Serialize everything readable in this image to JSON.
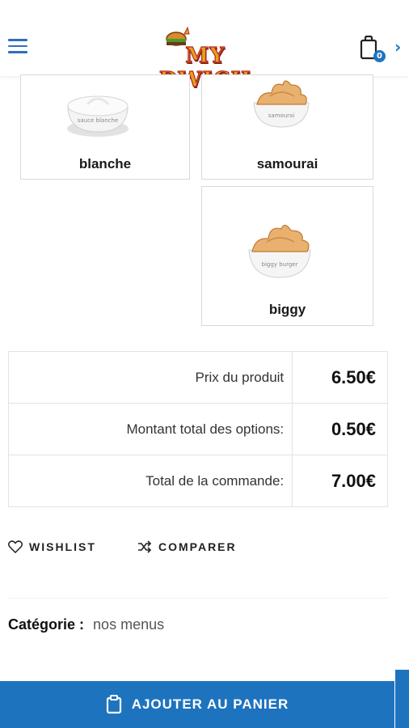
{
  "header": {
    "logo_text": "MY DWICH",
    "cart_count": "0"
  },
  "options": [
    {
      "label": "blanche",
      "jar_text": "sauce blanche"
    },
    {
      "label": "samourai",
      "jar_text": "samourai"
    },
    {
      "label": "biggy",
      "jar_text": "biggy burger"
    }
  ],
  "prices": {
    "rows": [
      {
        "label": "Prix du produit",
        "value": "6.50€"
      },
      {
        "label": "Montant total des options:",
        "value": "0.50€"
      },
      {
        "label": "Total de la commande:",
        "value": "7.00€"
      }
    ]
  },
  "actions": {
    "wishlist_label": "WISHLIST",
    "compare_label": "COMPARER"
  },
  "meta": {
    "category_label": "Catégorie :",
    "category_value": "nos menus"
  },
  "cta": {
    "add_to_cart_label": "AJOUTER AU PANIER"
  },
  "colors": {
    "accent": "#1e73be",
    "sauce": "#e8b170",
    "border": "#d9d9d9"
  },
  "icons": [
    "menu-icon",
    "cart-icon",
    "heart-icon",
    "shuffle-icon",
    "clipboard-icon"
  ]
}
